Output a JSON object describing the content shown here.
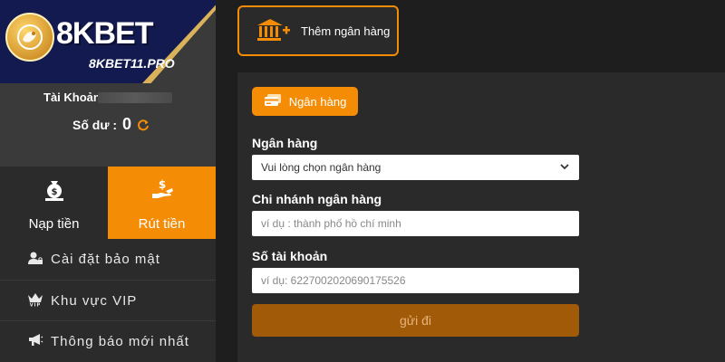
{
  "brand": {
    "name": "8KBET",
    "url": "8KBET11.PRO",
    "colors": {
      "navy": "#131a4f",
      "gold": "#d9b25a",
      "accent": "#f48c06"
    }
  },
  "account": {
    "label": "Tài Khoản",
    "balance_label": "Số dư :",
    "balance_value": "0"
  },
  "actions": [
    {
      "label": "Nạp tiền",
      "icon": "money-bag-icon"
    },
    {
      "label": "Rút tiền",
      "icon": "hand-dollar-icon"
    }
  ],
  "menu": [
    {
      "label": "Cài đặt bảo mật",
      "icon": "user-lock-icon"
    },
    {
      "label": "Khu vực VIP",
      "icon": "vip-crown-icon"
    },
    {
      "label": "Thông báo mới nhất",
      "icon": "megaphone-icon"
    }
  ],
  "toolbar": {
    "add_bank_label": "Thêm ngân hàng"
  },
  "form": {
    "tab_label": "Ngân hàng",
    "bank": {
      "label": "Ngân hàng",
      "value": "Vui lòng chọn ngân hàng"
    },
    "branch": {
      "label": "Chi nhánh ngân hàng",
      "placeholder": "ví dụ : thành phố hồ chí minh"
    },
    "account_number": {
      "label": "Số tài khoản",
      "placeholder": "ví dụ:  6227002020690175526"
    },
    "submit_label": "gửi đi"
  }
}
